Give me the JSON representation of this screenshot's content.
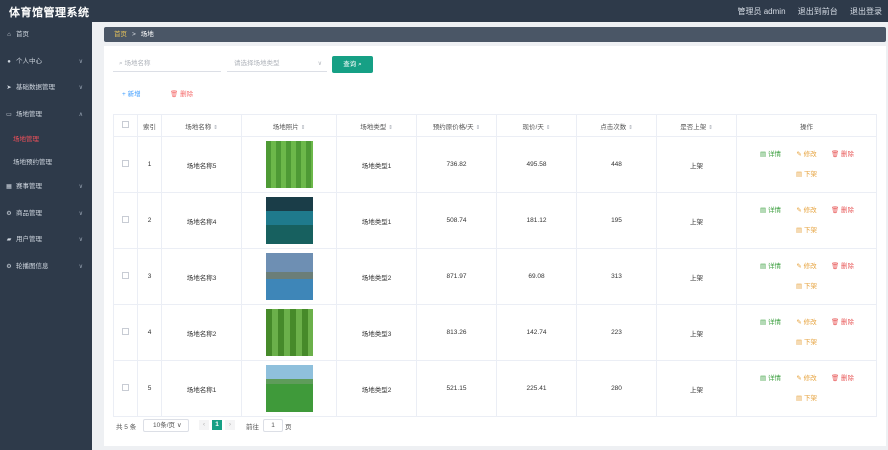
{
  "header": {
    "title": "体育馆管理系统",
    "admin": "管理员 admin",
    "to_frontend": "退出到前台",
    "logout": "退出登录"
  },
  "sidebar": {
    "items": [
      {
        "label": "首页",
        "icon": "home-icon"
      },
      {
        "label": "个人中心",
        "icon": "user-icon"
      },
      {
        "label": "基础数据管理",
        "icon": "send-icon"
      },
      {
        "label": "场地管理",
        "icon": "message-icon"
      },
      {
        "label": "赛事管理",
        "icon": "grid-icon"
      },
      {
        "label": "商品管理",
        "icon": "settings-icon"
      },
      {
        "label": "用户管理",
        "icon": "users-icon"
      },
      {
        "label": "轮播图信息",
        "icon": "settings-icon"
      }
    ],
    "sub_items": [
      "场地管理",
      "场地预约管理"
    ],
    "active_color": "#f0505a",
    "bg_color": "#2e3a4a"
  },
  "breadcrumb": {
    "home": "首页",
    "sep": ">",
    "current": "场地"
  },
  "search": {
    "name_placeholder": "场地名称",
    "type_placeholder": "请选择场地类型",
    "query_label": "查询"
  },
  "actions": {
    "add_label": "新增",
    "delete_label": "删除"
  },
  "table": {
    "headers": [
      "索引",
      "场地名称",
      "场地照片",
      "场地类型",
      "预约原价格/天",
      "现价/天",
      "点击次数",
      "是否上架",
      "操作"
    ],
    "rows": [
      {
        "index": "1",
        "name": "场地名称5",
        "type": "场地类型1",
        "orig_price": "736.82",
        "price": "495.58",
        "clicks": "448",
        "status": "上架"
      },
      {
        "index": "2",
        "name": "场地名称4",
        "type": "场地类型1",
        "orig_price": "508.74",
        "price": "181.12",
        "clicks": "195",
        "status": "上架"
      },
      {
        "index": "3",
        "name": "场地名称3",
        "type": "场地类型2",
        "orig_price": "871.97",
        "price": "69.08",
        "clicks": "313",
        "status": "上架"
      },
      {
        "index": "4",
        "name": "场地名称2",
        "type": "场地类型3",
        "orig_price": "813.26",
        "price": "142.74",
        "clicks": "223",
        "status": "上架"
      },
      {
        "index": "5",
        "name": "场地名称1",
        "type": "场地类型2",
        "orig_price": "521.15",
        "price": "225.41",
        "clicks": "280",
        "status": "上架"
      }
    ],
    "ops": {
      "detail": "详情",
      "edit": "修改",
      "delete": "删除",
      "down": "下架"
    }
  },
  "pager": {
    "total": "共 5 条",
    "page_size": "10条/页",
    "current": "1",
    "goto_prefix": "前往",
    "goto_value": "1",
    "goto_suffix": "页"
  },
  "colors": {
    "accent": "#16a085",
    "link": "#409eff",
    "danger": "#f56c6c",
    "warning": "#e6a23c",
    "success": "#3fa142"
  }
}
